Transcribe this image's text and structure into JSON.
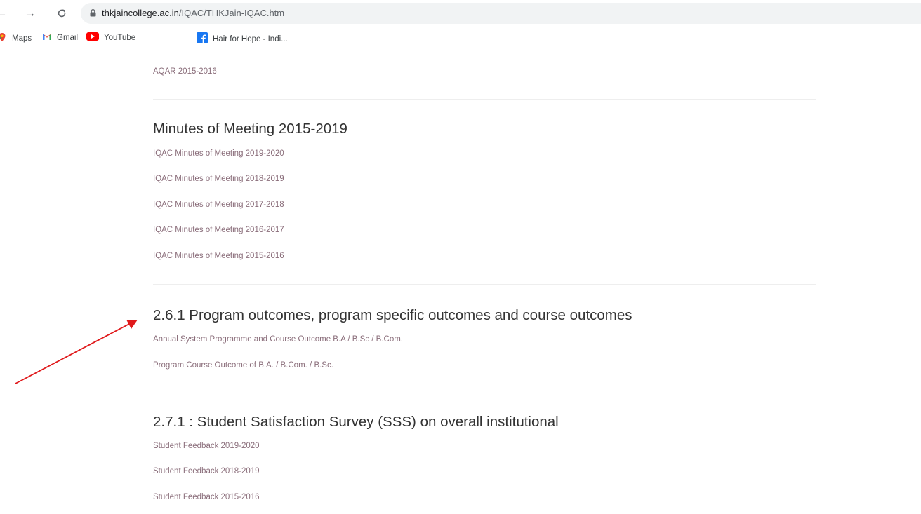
{
  "browser": {
    "back_icon": "back-arrow-icon",
    "forward_icon": "forward-arrow-icon",
    "reload_icon": "reload-icon",
    "url_host": "thkjaincollege.ac.in",
    "url_path": "/IQAC/THKJain-IQAC.htm"
  },
  "bookmarks": [
    {
      "label": "Maps",
      "icon": "maps-icon"
    },
    {
      "label": "Gmail",
      "icon": "gmail-icon"
    },
    {
      "label": "YouTube",
      "icon": "youtube-icon"
    },
    {
      "label": "Hair for Hope - Indi...",
      "icon": "facebook-icon"
    }
  ],
  "page": {
    "aqar_link": "AQAR 2015-2016",
    "sections": [
      {
        "heading": "Minutes of Meeting 2015-2019",
        "links": [
          "IQAC Minutes of Meeting 2019-2020",
          "IQAC Minutes of Meeting 2018-2019",
          "IQAC Minutes of Meeting 2017-2018",
          "IQAC Minutes of Meeting 2016-2017",
          "IQAC Minutes of Meeting 2015-2016"
        ]
      },
      {
        "heading": "2.6.1 Program outcomes, program specific outcomes and course outcomes",
        "links": [
          "Annual System Programme and Course Outcome B.A / B.Sc / B.Com.",
          "Program Course Outcome of B.A. / B.Com. / B.Sc."
        ]
      },
      {
        "heading": "2.7.1 : Student Satisfaction Survey (SSS) on overall institutional",
        "links": [
          "Student Feedback 2019-2020",
          "Student Feedback 2018-2019",
          "Student Feedback 2015-2016"
        ]
      }
    ]
  },
  "colors": {
    "link": "#8a6d7a",
    "heading": "#333333",
    "annotation_arrow": "#e0191b"
  }
}
